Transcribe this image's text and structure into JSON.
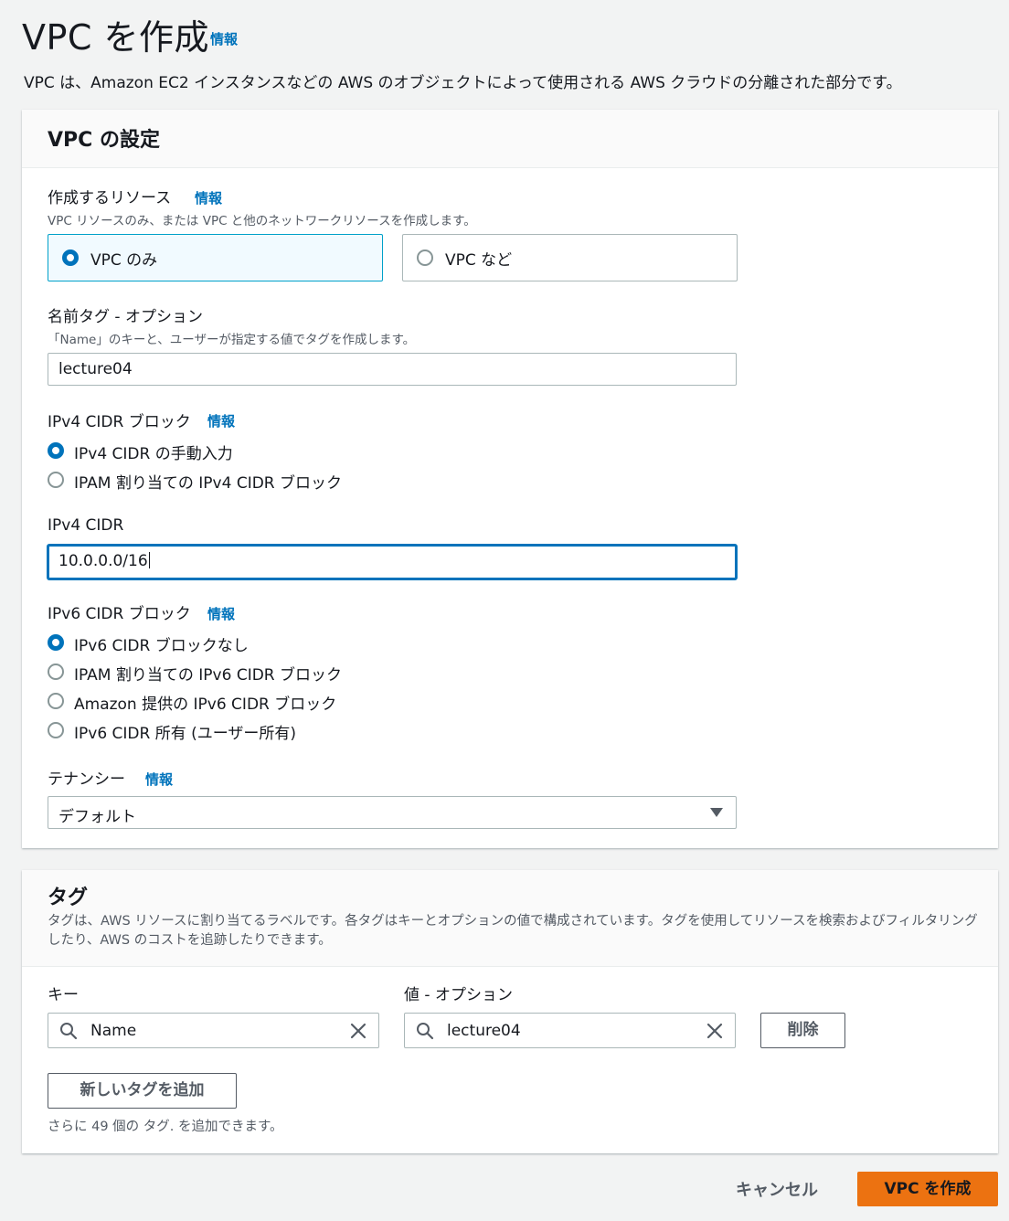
{
  "page": {
    "title": "VPC を作成",
    "info": "情報",
    "description": "VPC は、Amazon EC2 インスタンスなどの AWS のオブジェクトによって使用される AWS クラウドの分離された部分です。"
  },
  "vpc_settings": {
    "title": "VPC の設定",
    "resources": {
      "label": "作成するリソース",
      "info": "情報",
      "description": "VPC リソースのみ、または VPC と他のネットワークリソースを作成します。",
      "options": [
        "VPC のみ",
        "VPC など"
      ],
      "selected": "VPC のみ"
    },
    "name_tag": {
      "label": "名前タグ - オプション",
      "description": "「Name」のキーと、ユーザーが指定する値でタグを作成します。",
      "value": "lecture04"
    },
    "ipv4_block": {
      "label": "IPv4 CIDR ブロック",
      "info": "情報",
      "options": [
        "IPv4 CIDR の手動入力",
        "IPAM 割り当ての IPv4 CIDR ブロック"
      ],
      "selected": "IPv4 CIDR の手動入力"
    },
    "ipv4_cidr": {
      "label": "IPv4 CIDR",
      "value": "10.0.0.0/16"
    },
    "ipv6_block": {
      "label": "IPv6 CIDR ブロック",
      "info": "情報",
      "options": [
        "IPv6 CIDR ブロックなし",
        "IPAM 割り当ての IPv6 CIDR ブロック",
        "Amazon 提供の IPv6 CIDR ブロック",
        "IPv6 CIDR 所有 (ユーザー所有)"
      ],
      "selected": "IPv6 CIDR ブロックなし"
    },
    "tenancy": {
      "label": "テナンシー",
      "info": "情報",
      "value": "デフォルト"
    }
  },
  "tags": {
    "title": "タグ",
    "description": "タグは、AWS リソースに割り当てるラベルです。各タグはキーとオプションの値で構成されています。タグを使用してリソースを検索およびフィルタリングしたり、AWS のコストを追跡したりできます。",
    "key_label": "キー",
    "value_label": "値 - オプション",
    "key_value": "Name",
    "value_value": "lecture04",
    "remove_button": "削除",
    "add_button": "新しいタグを追加",
    "remaining": "さらに 49 個の タグ. を追加できます。"
  },
  "footer": {
    "cancel": "キャンセル",
    "create": "VPC を作成"
  },
  "colors": {
    "link": "#0073bb",
    "primary_button": "#ec7211",
    "background": "#f2f3f3"
  }
}
